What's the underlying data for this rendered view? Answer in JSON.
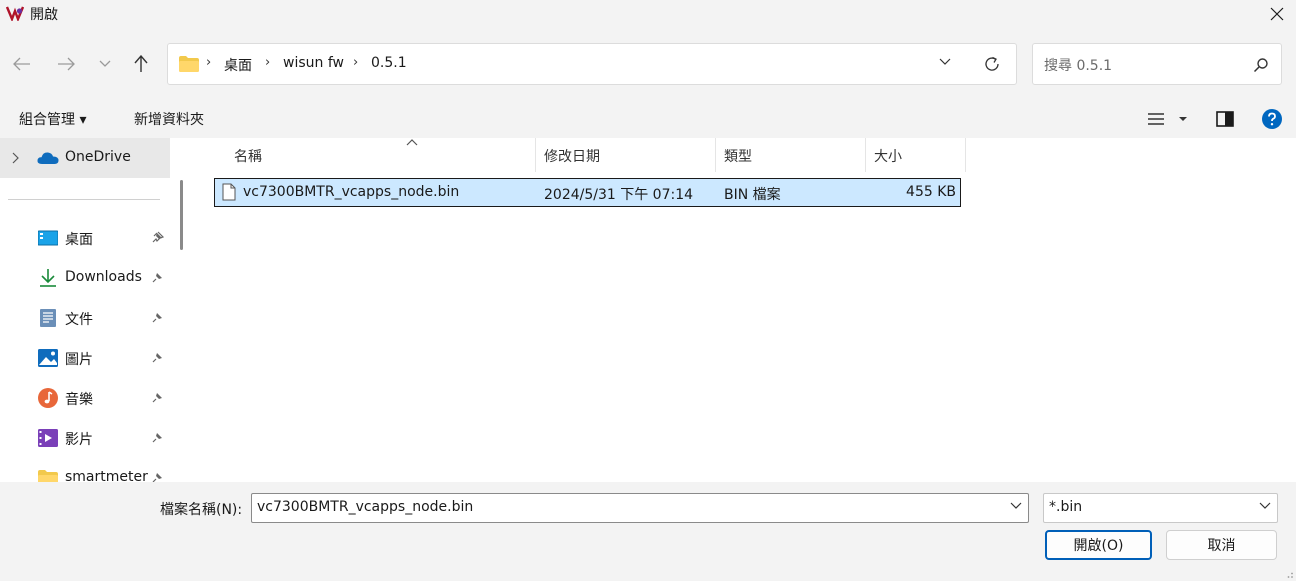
{
  "window": {
    "title": "開啟"
  },
  "nav": {
    "breadcrumbs": [
      "桌面",
      "wisun fw",
      "0.5.1"
    ],
    "search_placeholder": "搜尋 0.5.1"
  },
  "toolbar": {
    "organize_label": "組合管理 ▾",
    "new_folder_label": "新增資料夾"
  },
  "sidebar": {
    "onedrive_label": "OneDrive",
    "items": [
      {
        "label": "桌面",
        "icon": "desktop-icon"
      },
      {
        "label": "Downloads",
        "icon": "download-icon"
      },
      {
        "label": "文件",
        "icon": "document-icon"
      },
      {
        "label": "圖片",
        "icon": "pictures-icon"
      },
      {
        "label": "音樂",
        "icon": "music-icon"
      },
      {
        "label": "影片",
        "icon": "video-icon"
      },
      {
        "label": "smartmeter",
        "icon": "folder-icon"
      }
    ]
  },
  "filelist": {
    "columns": [
      "名稱",
      "修改日期",
      "類型",
      "大小"
    ],
    "rows": [
      {
        "name": "vc7300BMTR_vcapps_node.bin",
        "modified": "2024/5/31 下午 07:14",
        "type": "BIN 檔案",
        "size": "455 KB"
      }
    ]
  },
  "footer": {
    "filename_label": "檔案名稱(N):",
    "filename_value": "vc7300BMTR_vcapps_node.bin",
    "filetype_value": "*.bin",
    "open_label": "開啟(O)",
    "cancel_label": "取消"
  },
  "colors": {
    "selection": "#cce8ff",
    "accent": "#005fb8",
    "folder": "#f2c94c"
  }
}
